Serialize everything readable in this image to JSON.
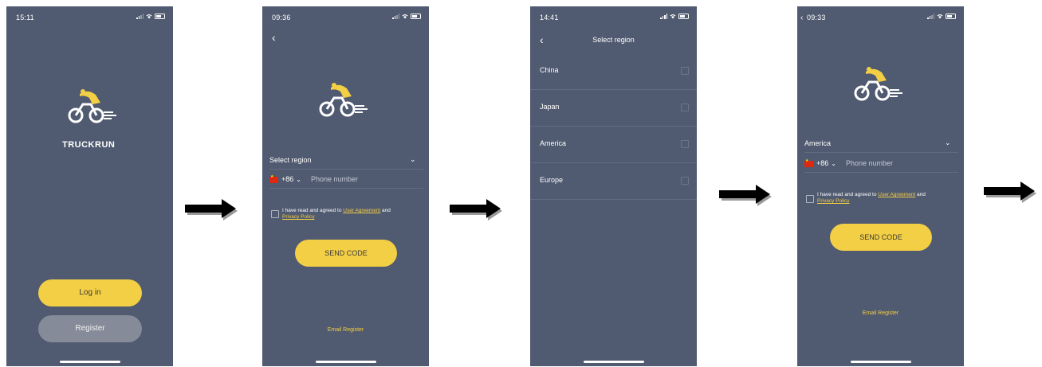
{
  "screens": [
    {
      "time": "15:11",
      "brand": "TRUCKRUN",
      "login_label": "Log in",
      "register_label": "Register"
    },
    {
      "time": "09:36",
      "back_symbol": "‹",
      "region_placeholder": "Select region",
      "country_code": "+86",
      "phone_placeholder": "Phone number",
      "agree_text": "I have read and agreed to",
      "user_agreement": "User Agreement",
      "and": "and",
      "privacy_policy": "Privacy Policy",
      "send_code": "SEND CODE",
      "email_register": "Email Register"
    },
    {
      "time": "14:41",
      "back_symbol": "‹",
      "title": "Select region",
      "regions": [
        "China",
        "Japan",
        "America",
        "Europe"
      ]
    },
    {
      "time": "09:33",
      "region_value": "America",
      "country_code": "+86",
      "phone_placeholder": "Phone number",
      "agree_text": "I have read and agreed to",
      "user_agreement": "User Agreement",
      "and": "and",
      "privacy_policy": "Privacy Policy",
      "send_code": "SEND CODE",
      "email_register": "Email Register"
    }
  ],
  "colors": {
    "screen_bg": "#505a70",
    "accent_yellow": "#f3cf45",
    "register_grey": "#858b99",
    "flag_red": "#de2910"
  },
  "icons": [
    "signal-icon",
    "wifi-icon",
    "battery-icon",
    "cyclist-logo-icon",
    "chevron-down-icon",
    "back-chevron-icon",
    "arrow-right-icon"
  ]
}
